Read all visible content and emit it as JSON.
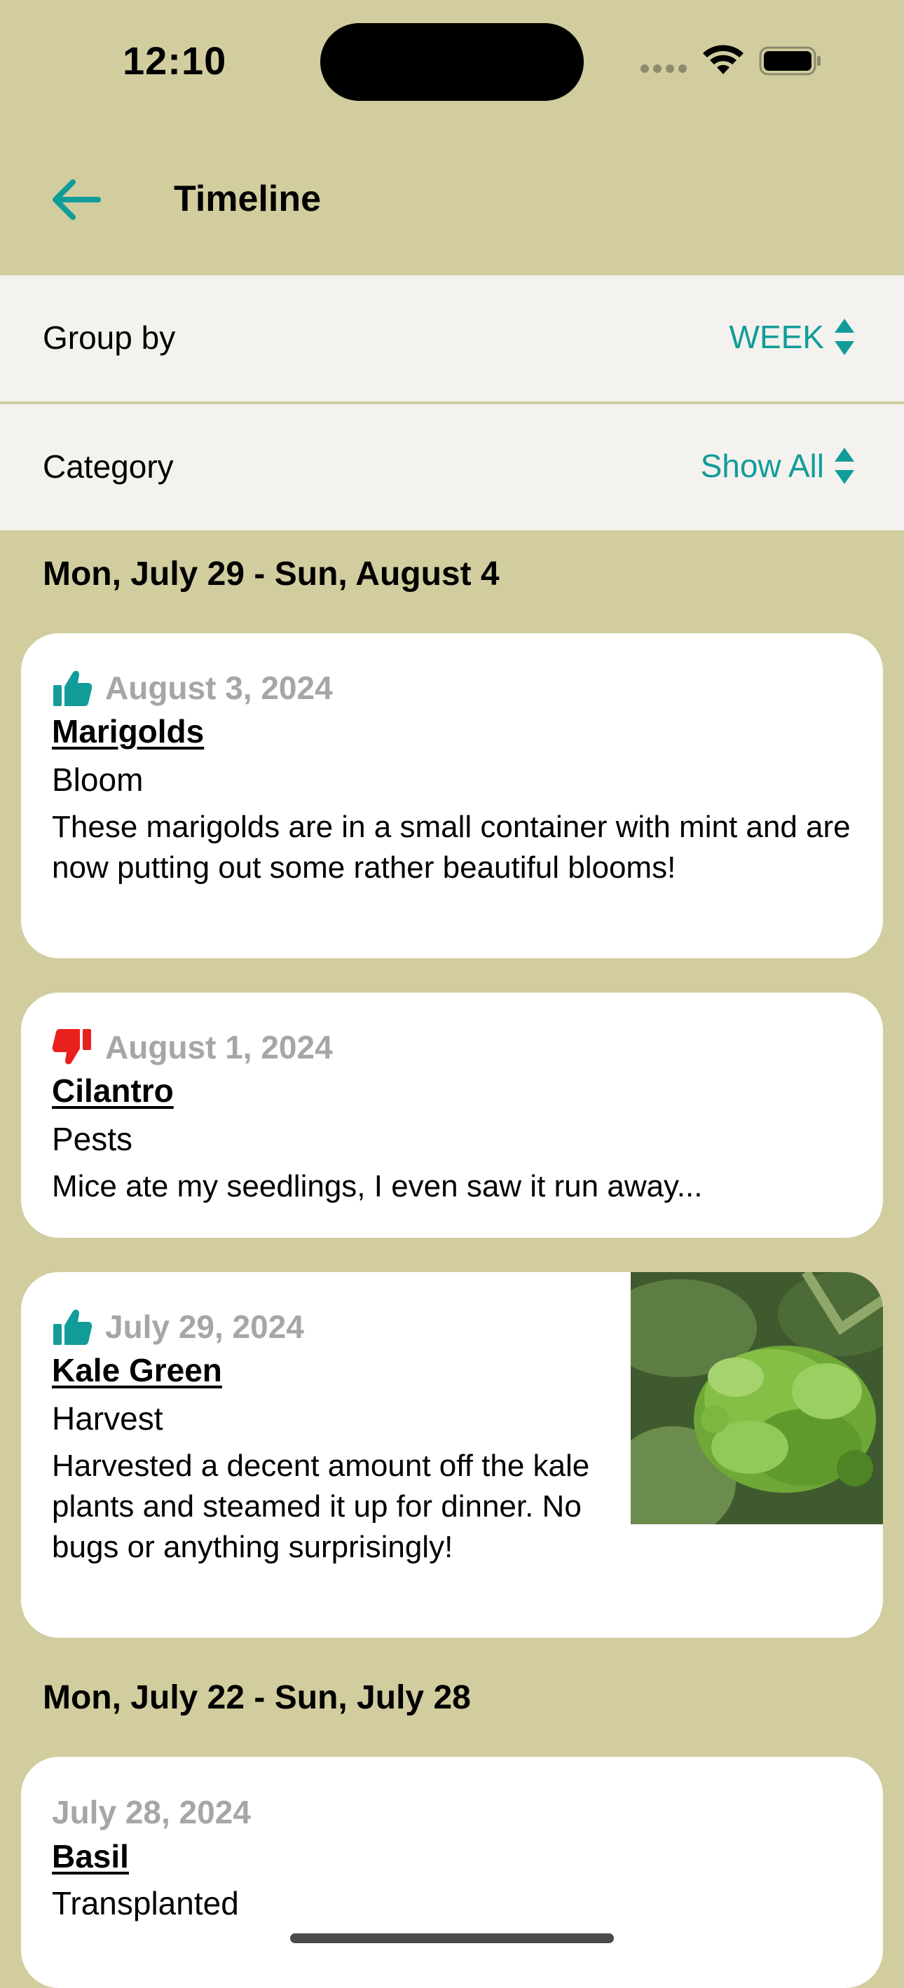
{
  "status_bar": {
    "time": "12:10"
  },
  "nav": {
    "title": "Timeline"
  },
  "filters": {
    "group_by_label": "Group by",
    "group_by_value": "WEEK",
    "category_label": "Category",
    "category_value": "Show All"
  },
  "colors": {
    "accent": "#119C99",
    "background": "#D2CD9F",
    "positive": "#119C99",
    "negative": "#E8211D"
  },
  "sections": [
    {
      "header": "Mon, July 29 - Sun, August 4",
      "entries": [
        {
          "sentiment": "thumbs-up-icon",
          "date": "August 3, 2024",
          "plant": "Marigolds",
          "category": "Bloom",
          "note": "These marigolds are in a small container with mint and are now putting out some rather beautiful blooms!"
        },
        {
          "sentiment": "thumbs-down-icon",
          "date": "August 1, 2024",
          "plant": "Cilantro",
          "category": "Pests",
          "note": "Mice ate my seedlings, I even saw it run away..."
        },
        {
          "sentiment": "thumbs-up-icon",
          "date": "July 29, 2024",
          "plant": "Kale Green",
          "category": "Harvest",
          "note": "Harvested a decent amount off the kale plants and steamed it up for dinner. No bugs or anything surprisingly!"
        }
      ]
    },
    {
      "header": "Mon, July 22 - Sun, July 28",
      "entries": [
        {
          "date": "July 28, 2024",
          "plant": "Basil",
          "category": "Transplanted"
        }
      ]
    }
  ]
}
